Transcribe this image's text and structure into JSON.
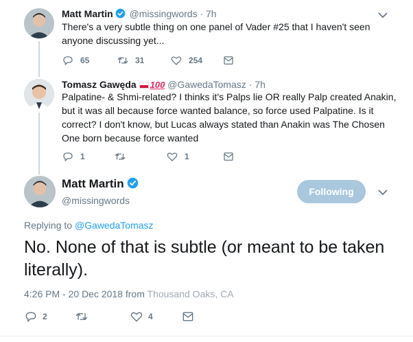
{
  "tweets": [
    {
      "name": "Matt Martin",
      "verified": true,
      "handle": "@missingwords",
      "time": "· 7h",
      "text": "There's a very subtle thing on one panel of Vader #25 that I haven't seen anyone discussing yet...",
      "replies": "65",
      "retweets": "31",
      "likes": "254"
    },
    {
      "name": "Tomasz Gawęda",
      "emoji": "100",
      "handle": "@GawedaTomasz",
      "time": "· 7h",
      "text": "Palpatine- & Shmi-related? I thinks it's Palps lie OR really Palp created Anakin, but it was all because force wanted balance, so force used Palpatine. Is it correct? I don't know, but Lucas always stated than Anakin was The Chosen One born because force wanted",
      "replies": "1",
      "retweets": "",
      "likes": "1"
    }
  ],
  "main_tweet": {
    "name": "Matt Martin",
    "handle": "@missingwords",
    "follow_label": "Following",
    "replying_prefix": "Replying to",
    "replying_to": "@GawedaTomasz",
    "text": "No. None of that is subtle (or meant to be taken literally).",
    "timestamp": "4:26 PM - 20 Dec 2018 from",
    "location": "Thousand Oaks, CA",
    "replies": "2",
    "retweets": "",
    "likes": "4"
  },
  "colors": {
    "accent": "#1da1f2",
    "muted": "#657786",
    "following_button": "#a9c7dd"
  },
  "icons": [
    "verified-badge-icon",
    "chevron-down-icon",
    "reply-icon",
    "retweet-icon",
    "like-icon",
    "message-icon"
  ]
}
